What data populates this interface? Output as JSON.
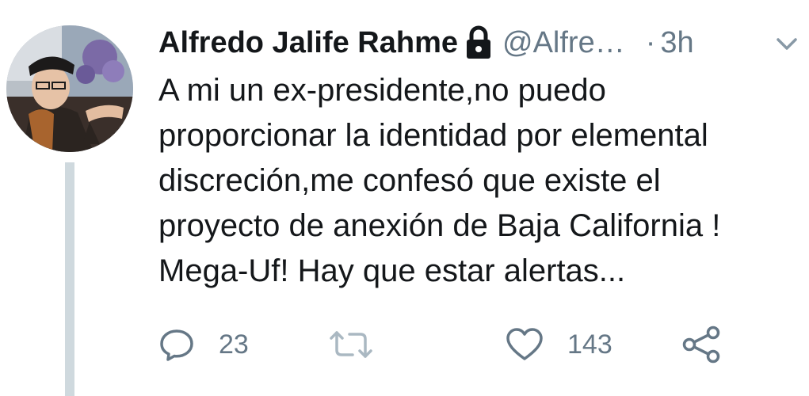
{
  "author": {
    "display_name": "Alfredo Jalife Rahme",
    "handle": "@Alfre…",
    "separator": "·",
    "time": "3h"
  },
  "tweet": {
    "lines": [
      "A mi un ex-presidente,no puedo",
      "proporcionar la identidad por elemental",
      "discreción,me confesó que existe el",
      "proyecto de anexión de Baja California !",
      "Mega-Uf! Hay que estar alertas..."
    ]
  },
  "actions": {
    "reply_count": "23",
    "retweet_count": "",
    "like_count": "143"
  },
  "icons": {
    "lock": "lock-icon",
    "chevron": "chevron-down-icon",
    "reply": "reply-icon",
    "retweet": "retweet-icon",
    "like": "heart-icon",
    "share": "share-icon"
  },
  "colors": {
    "text": "#14171a",
    "muted": "#657786",
    "icon": "#657786",
    "thread_line": "#cfd9de",
    "retweet_disabled": "#aab8c2"
  }
}
